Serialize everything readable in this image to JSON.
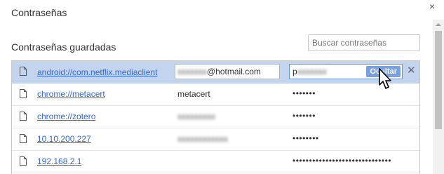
{
  "dialog": {
    "title": "Contraseñas",
    "close_glyph": "×"
  },
  "saved": {
    "title": "Contraseñas guardadas",
    "search_placeholder": "Buscar contraseñas"
  },
  "rows": [
    {
      "site": "android://com.netflix.mediaclient",
      "user_visible": "@hotmail.com",
      "pass_first": "p",
      "hide_label": "Ocultar",
      "delete_glyph": "✕"
    },
    {
      "site": "chrome://metacert",
      "user": "metacert",
      "password_mask": "•••••••"
    },
    {
      "site": "chrome://zotero",
      "password_mask": "•••••••"
    },
    {
      "site": "10.10.200.227",
      "password_mask": "••••••••"
    },
    {
      "site": "192.168.2.1",
      "password_mask": "••••••••••••••••••••••••••••••"
    }
  ],
  "colors": {
    "link": "#3367d6",
    "selected_row": "#c3d4ee",
    "hide_button": "#7aa0e0"
  },
  "icons": {
    "row": "document-icon",
    "pointer": "mouse-pointer-icon"
  }
}
